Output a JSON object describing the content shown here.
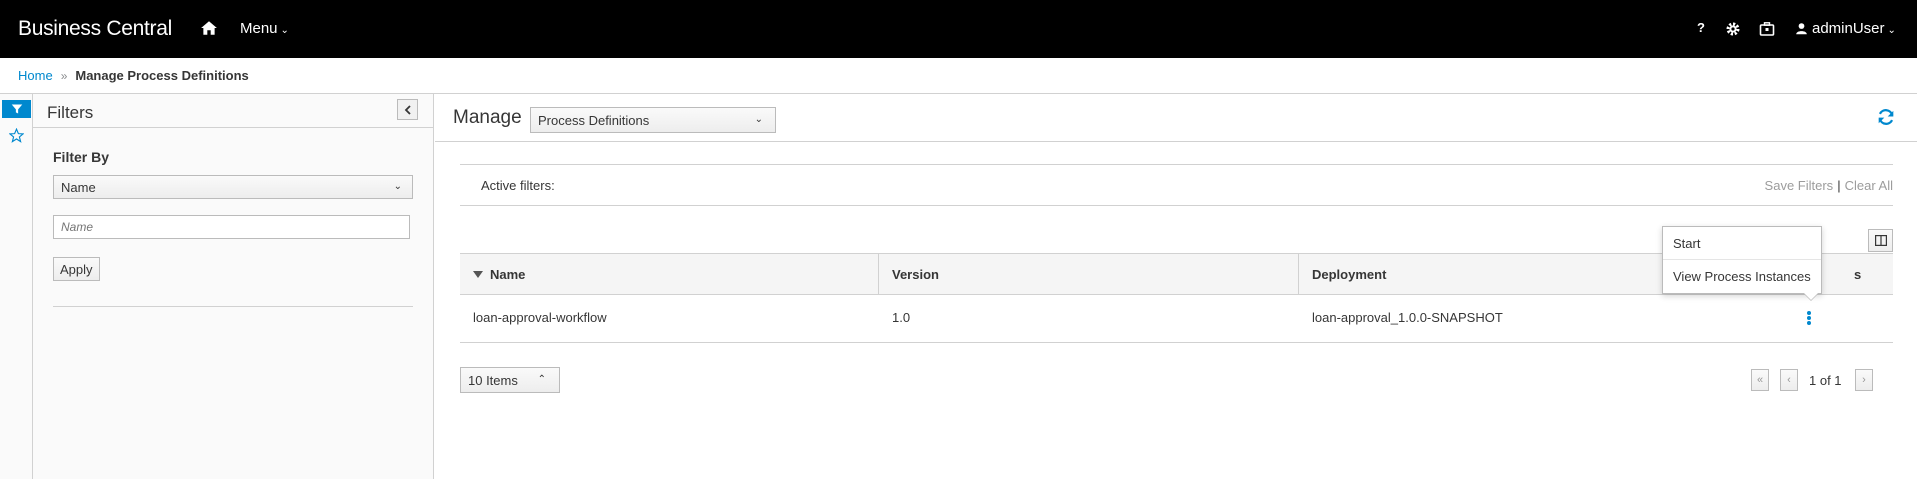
{
  "app": {
    "title": "Business Central"
  },
  "topnav": {
    "menu_label": "Menu",
    "help_label": "?",
    "user_label": "adminUser"
  },
  "breadcrumb": {
    "home": "Home",
    "separator": "»",
    "current": "Manage Process Definitions"
  },
  "filters": {
    "title": "Filters",
    "filter_by_label": "Filter By",
    "field_select": "Name",
    "value_placeholder": "Name",
    "apply_label": "Apply"
  },
  "main": {
    "title": "Manage",
    "view_select": "Process Definitions"
  },
  "active_filters": {
    "label": "Active filters:",
    "save_label": "Save Filters",
    "separator": "|",
    "clear_label": "Clear All"
  },
  "table": {
    "columns": [
      "Name",
      "Version",
      "Deployment",
      "s"
    ],
    "rows": [
      {
        "name": "loan-approval-workflow",
        "version": "1.0",
        "deployment": "loan-approval_1.0.0-SNAPSHOT"
      }
    ]
  },
  "row_menu": {
    "items": [
      "Start",
      "View Process Instances"
    ]
  },
  "pagination": {
    "page_size": "10 Items",
    "first": "«",
    "prev": "‹",
    "next": "›",
    "info": "1 of 1"
  },
  "colors": {
    "accent": "#0088ce",
    "topbar": "#000000"
  },
  "icons": [
    "home-icon",
    "gear-icon",
    "briefcase-icon",
    "user-icon",
    "filter-icon",
    "star-icon",
    "refresh-icon",
    "columns-icon",
    "kebab-icon"
  ]
}
